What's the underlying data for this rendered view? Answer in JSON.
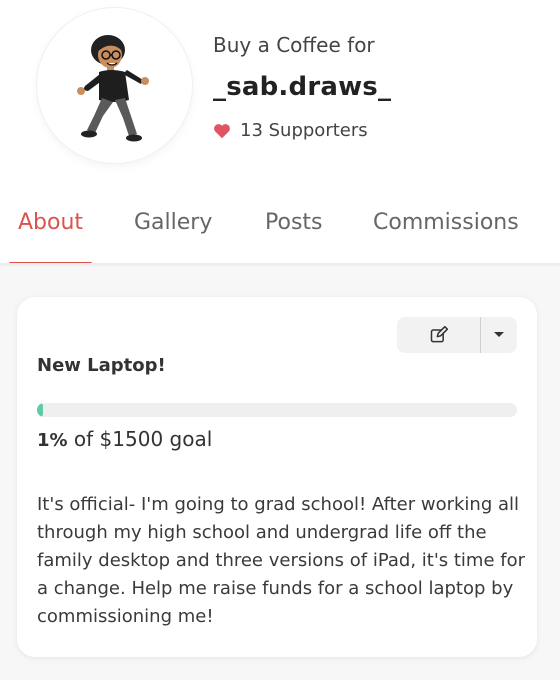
{
  "header": {
    "subtitle": "Buy a Coffee for",
    "creator_name": "_sab.draws_",
    "supporters_text": "13 Supporters",
    "heart_color": "#e0555f"
  },
  "tabs": [
    {
      "label": "About",
      "active": true
    },
    {
      "label": "Gallery",
      "active": false
    },
    {
      "label": "Posts",
      "active": false
    },
    {
      "label": "Commissions",
      "active": false
    }
  ],
  "goal": {
    "title": "New Laptop!",
    "percent": 1,
    "percent_label": "1%",
    "goal_text": "of $1500 goal",
    "description": "It's official- I'm going to grad school! After working all through my high school and undergrad life off the family desktop and three versions of iPad, it's time for a change. Help me raise funds for a school laptop by commissioning me!",
    "progress_color": "#5fcba4",
    "accent_color": "#d9534f"
  },
  "icons": {
    "edit": "edit-icon",
    "dropdown": "caret-down-icon",
    "heart": "heart-icon"
  }
}
